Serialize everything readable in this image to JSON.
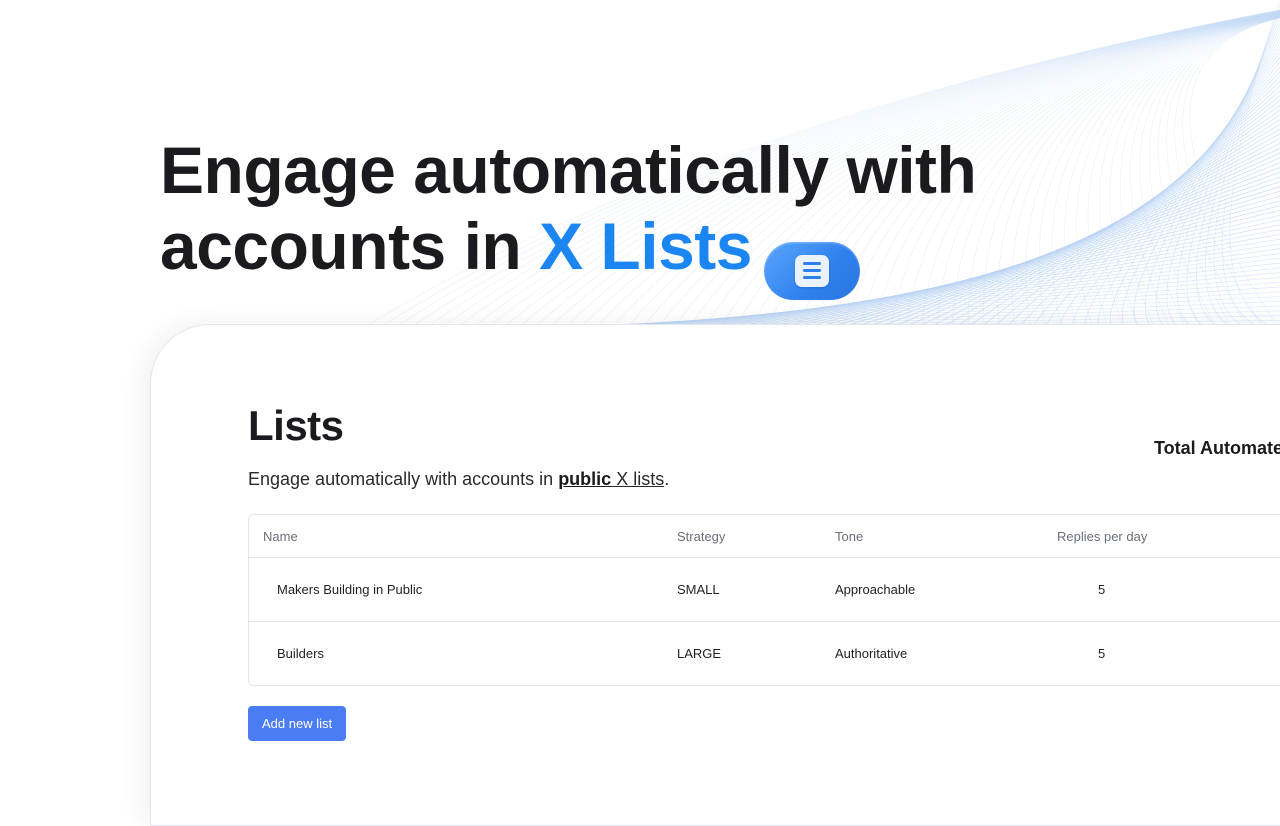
{
  "hero": {
    "line1": "Engage automatically with",
    "line2_prefix": "accounts in ",
    "line2_accent": "X Lists",
    "badge_icon": "document-list-icon"
  },
  "section": {
    "title": "Lists",
    "total_label": "Total Automate",
    "subtitle_prefix": "Engage automatically with accounts in ",
    "subtitle_strong_link": "public",
    "subtitle_link": " X lists",
    "subtitle_suffix": "."
  },
  "table": {
    "headers": {
      "name": "Name",
      "strategy": "Strategy",
      "tone": "Tone",
      "replies": "Replies per day"
    },
    "rows": [
      {
        "name": "Makers Building in Public",
        "strategy": "SMALL",
        "tone": "Approachable",
        "replies": "5"
      },
      {
        "name": "Builders",
        "strategy": "LARGE",
        "tone": "Authoritative",
        "replies": "5"
      }
    ]
  },
  "actions": {
    "add_label": "Add new list"
  },
  "colors": {
    "accent": "#1b86f2",
    "button": "#4a7cf4",
    "background_lines": "#b9d3f3"
  }
}
